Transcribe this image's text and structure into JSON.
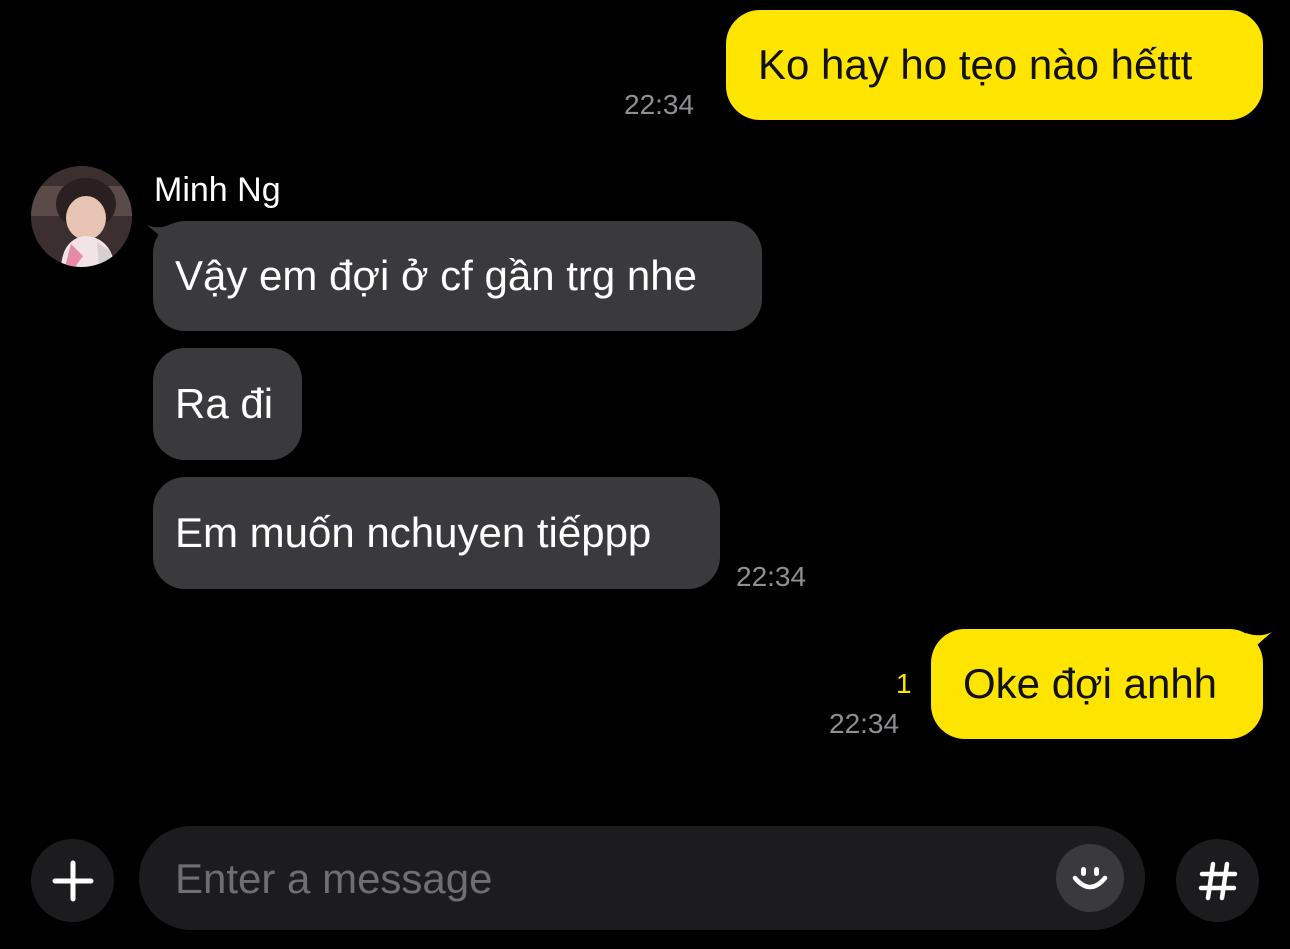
{
  "colors": {
    "background": "#000000",
    "my_bubble": "#FEE500",
    "their_bubble": "#3A3A3C",
    "timestamp": "#8E8E93",
    "unread_count": "#FEE500",
    "input_bg": "#1C1C1E"
  },
  "messages": [
    {
      "sender": "me",
      "text": "Ko hay ho tẹo nào hếttt",
      "time": "22:34"
    },
    {
      "sender": "Minh Ng",
      "text": "Vậy em đợi ở cf gần trg nhe"
    },
    {
      "sender": "Minh Ng",
      "text": "Ra đi"
    },
    {
      "sender": "Minh Ng",
      "text": "Em muốn nchuyen tiếppp",
      "time": "22:34"
    },
    {
      "sender": "me",
      "text": "Oke đợi anhh",
      "time": "22:34",
      "unread": "1"
    }
  ],
  "contact": {
    "name": "Minh Ng",
    "avatar": "avatar-photo"
  },
  "composer": {
    "placeholder": "Enter a message",
    "add_icon": "plus-icon",
    "emoji_icon": "smiley-icon",
    "hashtag_icon": "hashtag-icon"
  }
}
